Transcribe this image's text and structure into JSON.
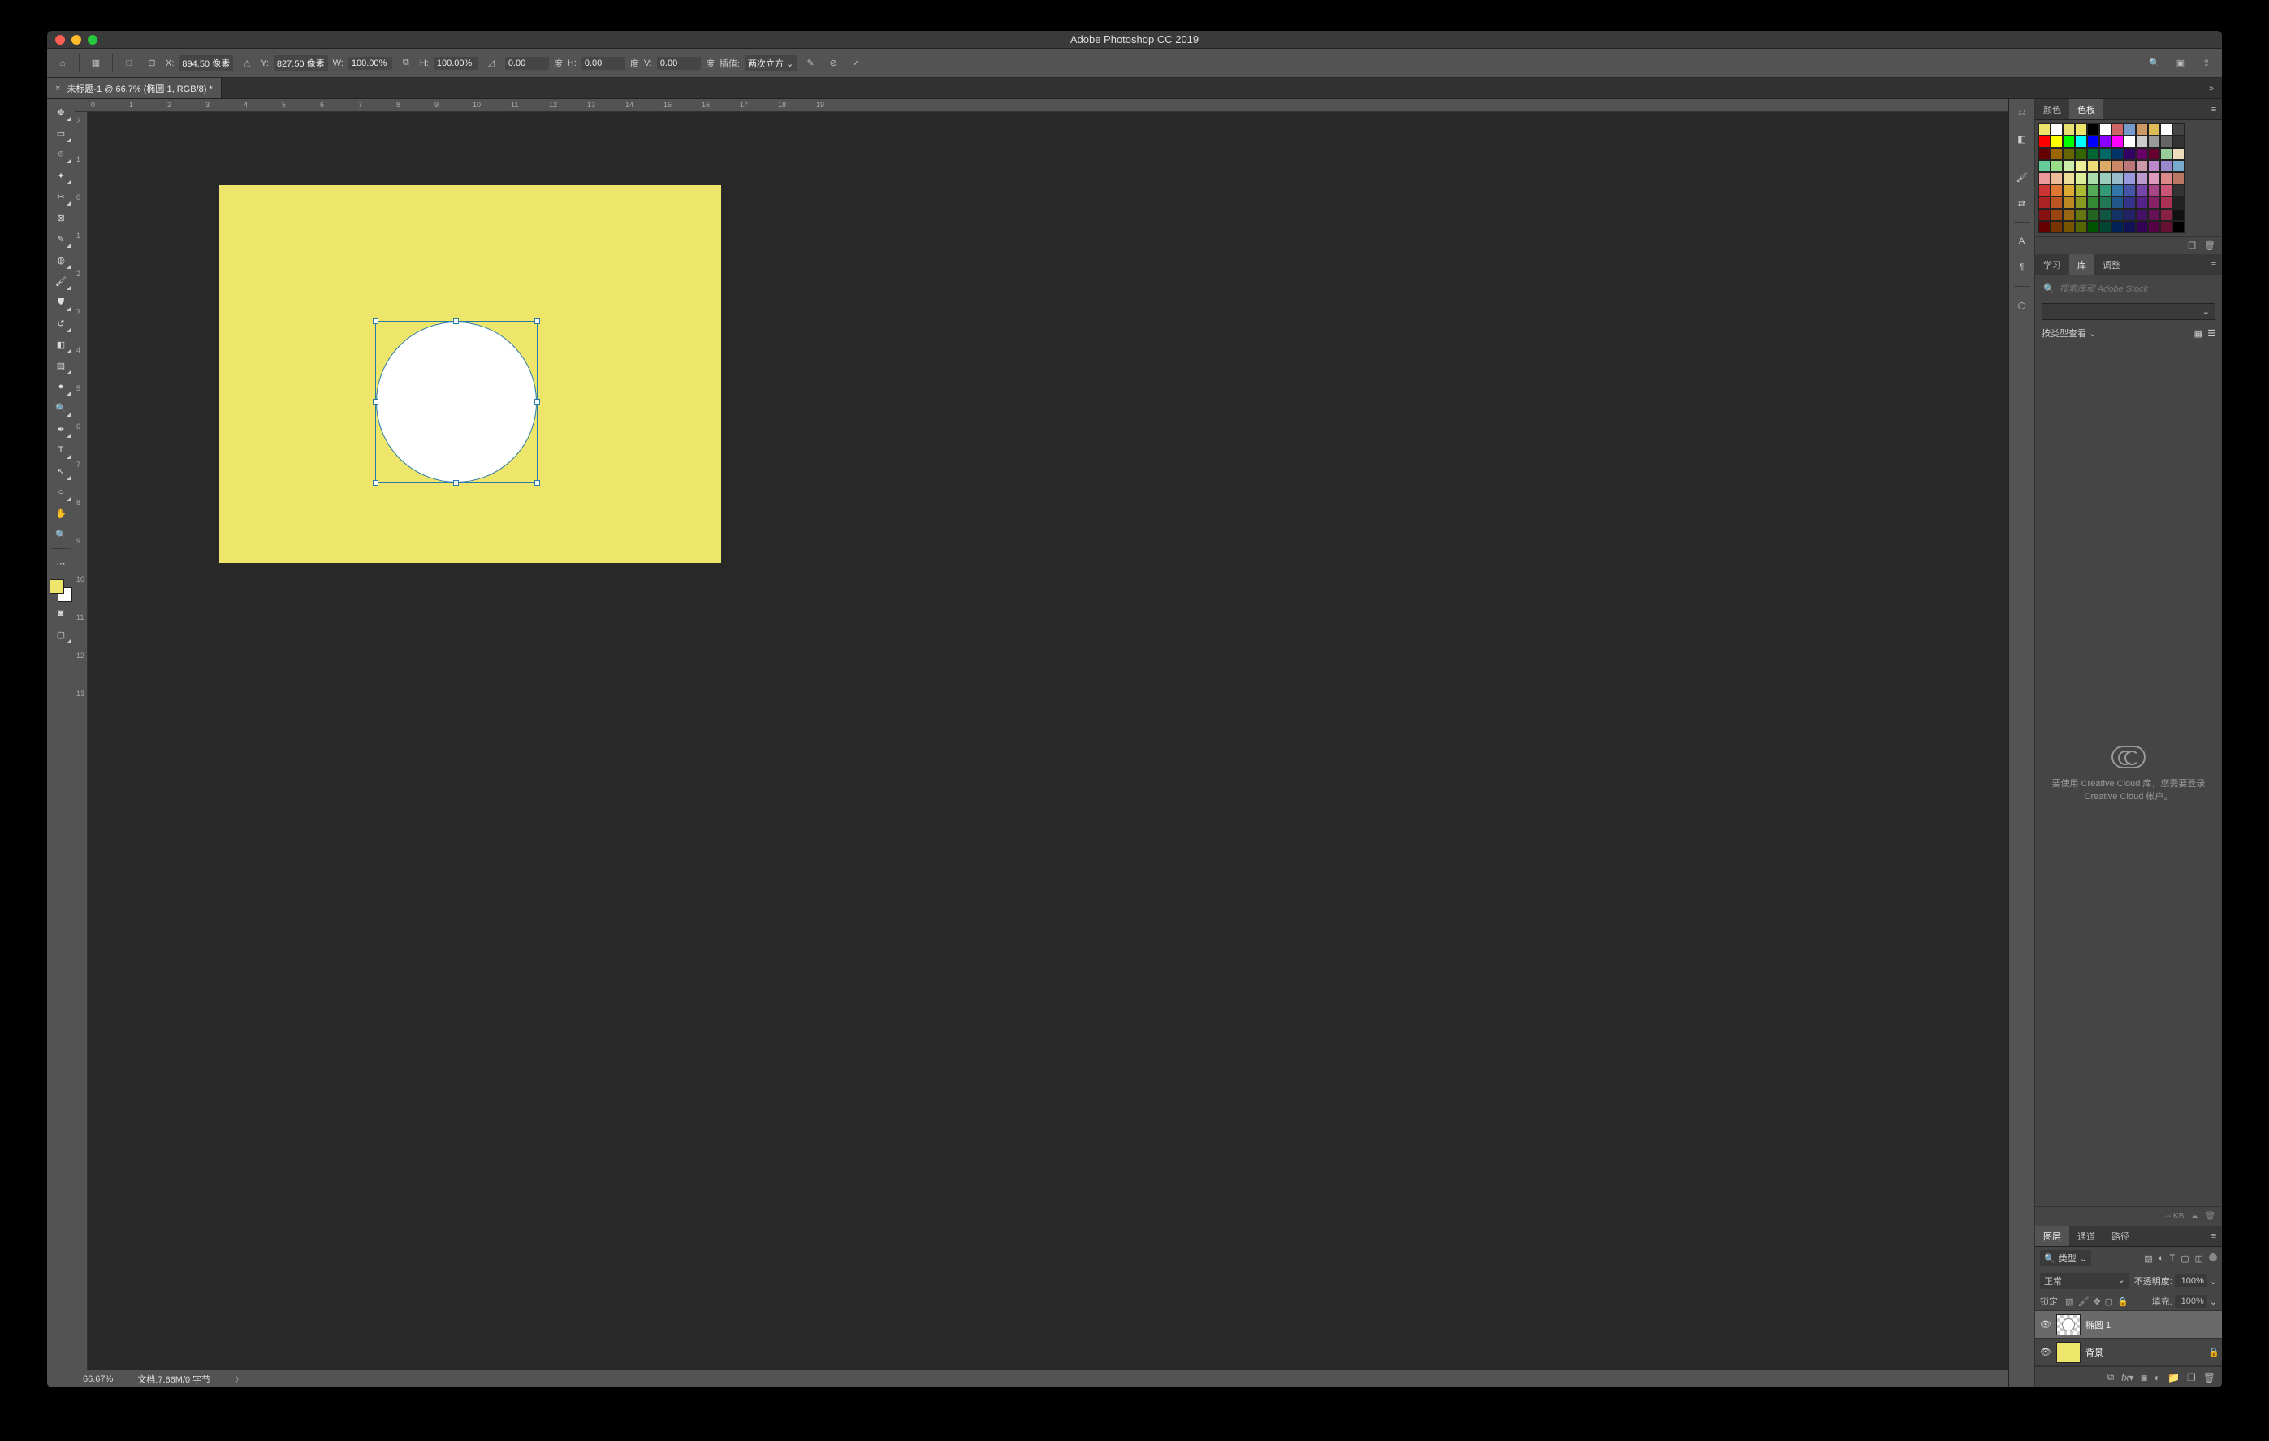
{
  "title": "Adobe Photoshop CC 2019",
  "optbar": {
    "x_lbl": "X:",
    "x": "894.50 像素",
    "y_lbl": "Y:",
    "y": "827.50 像素",
    "w_lbl": "W:",
    "w": "100.00%",
    "h_lbl": "H:",
    "h": "100.00%",
    "angle": "0.00",
    "angle_unit": "度",
    "h2_lbl": "H:",
    "h2": "0.00",
    "h2_unit": "度",
    "v_lbl": "V:",
    "v": "0.00",
    "v_unit": "度",
    "interp_lbl": "插值:",
    "interp": "两次立方"
  },
  "doctab": {
    "title": "未标题-1 @ 66.7% (椭圆 1, RGB/8) *"
  },
  "ruler_h": [
    "0",
    "1",
    "2",
    "3",
    "4",
    "5",
    "6",
    "7",
    "8",
    "9",
    "10",
    "11",
    "12",
    "13",
    "14",
    "15",
    "16",
    "17",
    "18",
    "19"
  ],
  "ruler_v": [
    "2",
    "1",
    "0",
    "1",
    "2",
    "3",
    "4",
    "5",
    "6",
    "7",
    "8",
    "9",
    "10",
    "11",
    "12",
    "13"
  ],
  "status": {
    "zoom": "66.67%",
    "doc": "文档:7.66M/0 字节"
  },
  "panels": {
    "color_tab": "颜色",
    "swatch_tab": "色板",
    "learn_tab": "学习",
    "lib_tab": "库",
    "adjust_tab": "调整",
    "search_placeholder": "搜索库和 Adobe Stock",
    "view_by": "按类型查看",
    "cc_msg": "要使用 Creative Cloud 库，您需要登录 Creative Cloud 帐户。",
    "kb": "-- KB",
    "layers_tab": "图层",
    "channels_tab": "通道",
    "paths_tab": "路径",
    "filter_label": "类型",
    "blend": "正常",
    "opacity_lbl": "不透明度:",
    "opacity": "100%",
    "lock_lbl": "锁定:",
    "fill_lbl": "填充:",
    "fill": "100%",
    "layer1": "椭圆 1",
    "layer2": "背景"
  },
  "swatch_rows": [
    [
      "#eee66a",
      "#ffffff",
      "#e8e073",
      "#eee66a",
      "#000000",
      "#ffffff",
      "#cc6666",
      "#7799cc",
      "#cc9966",
      "#ddbb55",
      "#ffffff",
      "#444444"
    ],
    [
      "#ff0000",
      "#ffff00",
      "#00ff00",
      "#00ffff",
      "#0000ff",
      "#8800ff",
      "#ff00ff",
      "#ffffff",
      "#cccccc",
      "#999999",
      "#666666",
      "#333333"
    ],
    [
      "#660000",
      "#996600",
      "#666600",
      "#336600",
      "#006633",
      "#006666",
      "#003366",
      "#330066",
      "#660066",
      "#660033",
      "#99cc99",
      "#eeddbb"
    ],
    [
      "#66cc99",
      "#99dd88",
      "#cceeaa",
      "#eeee99",
      "#eedd77",
      "#ddaa66",
      "#cc8866",
      "#bb7777",
      "#cc99aa",
      "#bb88cc",
      "#9988cc",
      "#77aacc"
    ],
    [
      "#ee9999",
      "#eebb99",
      "#eedd99",
      "#ddee99",
      "#aaddaa",
      "#99ccbb",
      "#99bbcc",
      "#9999dd",
      "#bb99cc",
      "#dd99bb",
      "#dd8888",
      "#bb7766"
    ],
    [
      "#cc3333",
      "#dd7733",
      "#ddaa33",
      "#aabb33",
      "#55aa55",
      "#339977",
      "#3377aa",
      "#4455aa",
      "#7744aa",
      "#aa4488",
      "#cc5577",
      "#333333"
    ],
    [
      "#aa2222",
      "#bb5522",
      "#bb8822",
      "#889922",
      "#338833",
      "#227755",
      "#225588",
      "#333388",
      "#552288",
      "#882266",
      "#aa3355",
      "#222222"
    ],
    [
      "#881111",
      "#994411",
      "#996611",
      "#667711",
      "#226622",
      "#115544",
      "#113366",
      "#222266",
      "#441166",
      "#661155",
      "#882244",
      "#111111"
    ],
    [
      "#660000",
      "#773300",
      "#775500",
      "#556600",
      "#005500",
      "#004433",
      "#002255",
      "#111155",
      "#330055",
      "#550044",
      "#661133",
      "#000000"
    ]
  ]
}
